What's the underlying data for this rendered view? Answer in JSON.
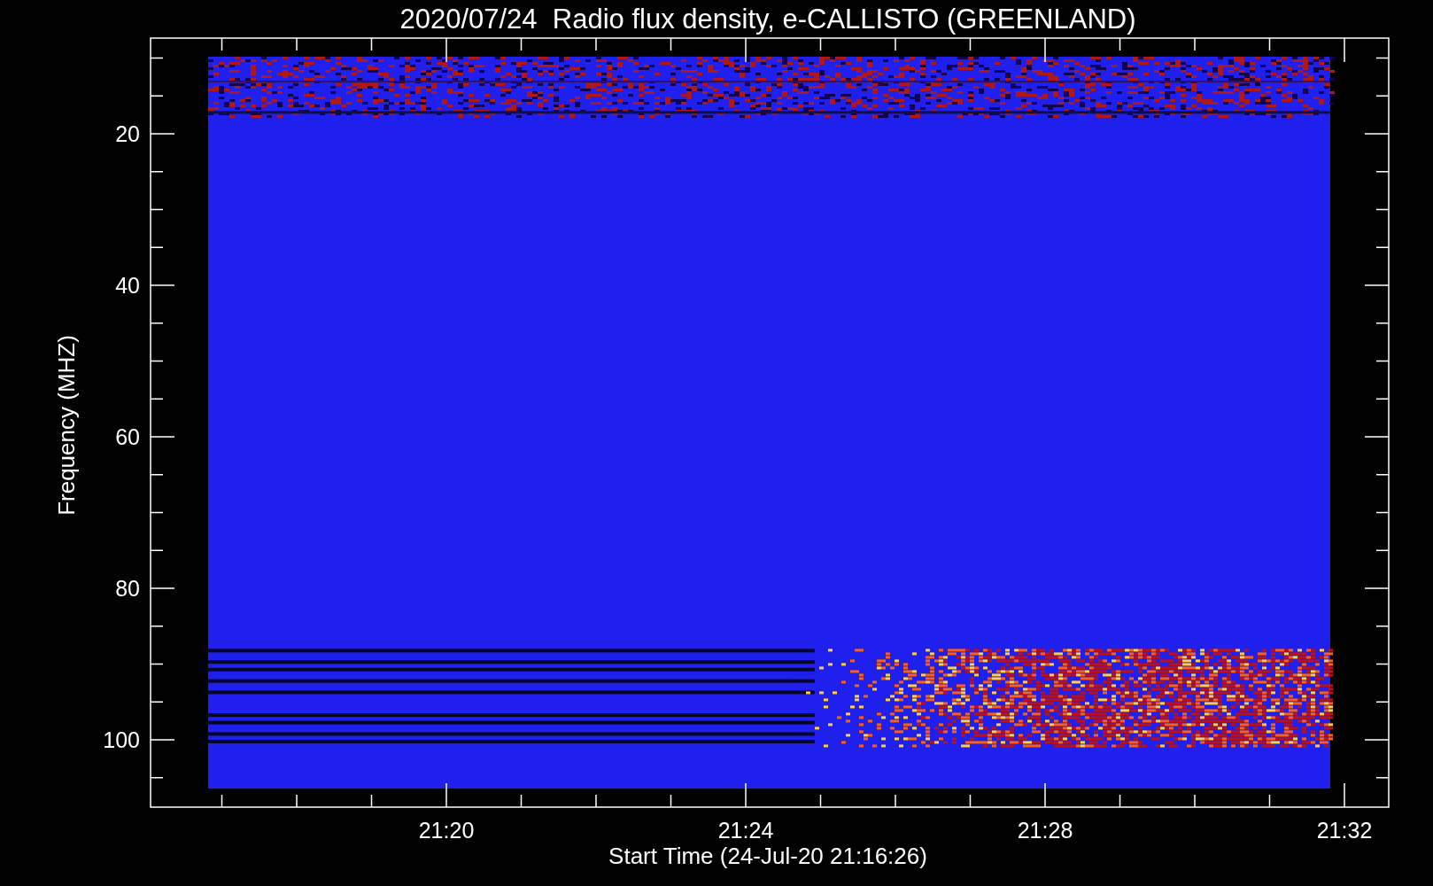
{
  "chart": {
    "title": "2020/07/24  Radio flux density, e-CALLISTO (GREENLAND)",
    "xlabel": "Start Time (24-Jul-20 21:16:26)",
    "ylabel": "Frequency (MHZ)",
    "xticks": [
      "21:20",
      "21:24",
      "21:28",
      "21:32"
    ],
    "yticks": [
      "20",
      "40",
      "60",
      "80",
      "100"
    ]
  }
}
